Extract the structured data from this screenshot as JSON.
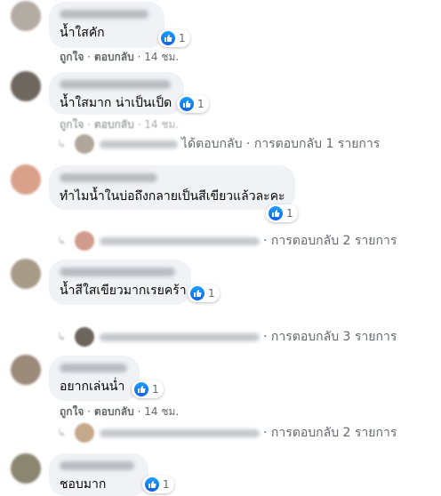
{
  "comments": [
    {
      "text": "น้ำใสคัก",
      "reactions": "1",
      "actions": {
        "like": "ถูกใจ",
        "sep": "·",
        "reply": "ตอบกลับ",
        "time": "14 ชม."
      }
    },
    {
      "text": "น้ำใสมาก น่าเป็นเป็ด",
      "reactions": "1",
      "actions": {
        "like": "ถูกใจ",
        "sep": "·",
        "reply": "ตอบกลับ",
        "time": "14 ชม."
      },
      "replies": {
        "text": "ได้ตอบกลับ · การตอบกลับ 1 รายการ"
      }
    },
    {
      "text": "ทำไมน้ำในบ่อถึงกลายเป็นสีเขียวแล้วละคะ",
      "reactions": "1",
      "replies": {
        "text": "· การตอบกลับ 2 รายการ"
      }
    },
    {
      "text": "น้ำสีใสเขียวมากเรยคร้า",
      "reactions": "1",
      "replies": {
        "text": "· การตอบกลับ 3 รายการ"
      }
    },
    {
      "text": "อยากเล่นน่ำ",
      "reactions": "1",
      "actions": {
        "like": "ถูกใจ",
        "sep": "·",
        "reply": "ตอบกลับ",
        "time": "14 ชม."
      },
      "replies": {
        "text": "· การตอบกลับ 2 รายการ"
      }
    },
    {
      "text": "ชอบมาก",
      "reactions": "1"
    }
  ],
  "icons": {
    "like": "thumbs-up-icon",
    "reply": "reply-arrow-icon"
  },
  "colors": {
    "like_blue": "#1877f2",
    "bubble_bg": "#f0f2f5",
    "meta_gray": "#65676b"
  }
}
